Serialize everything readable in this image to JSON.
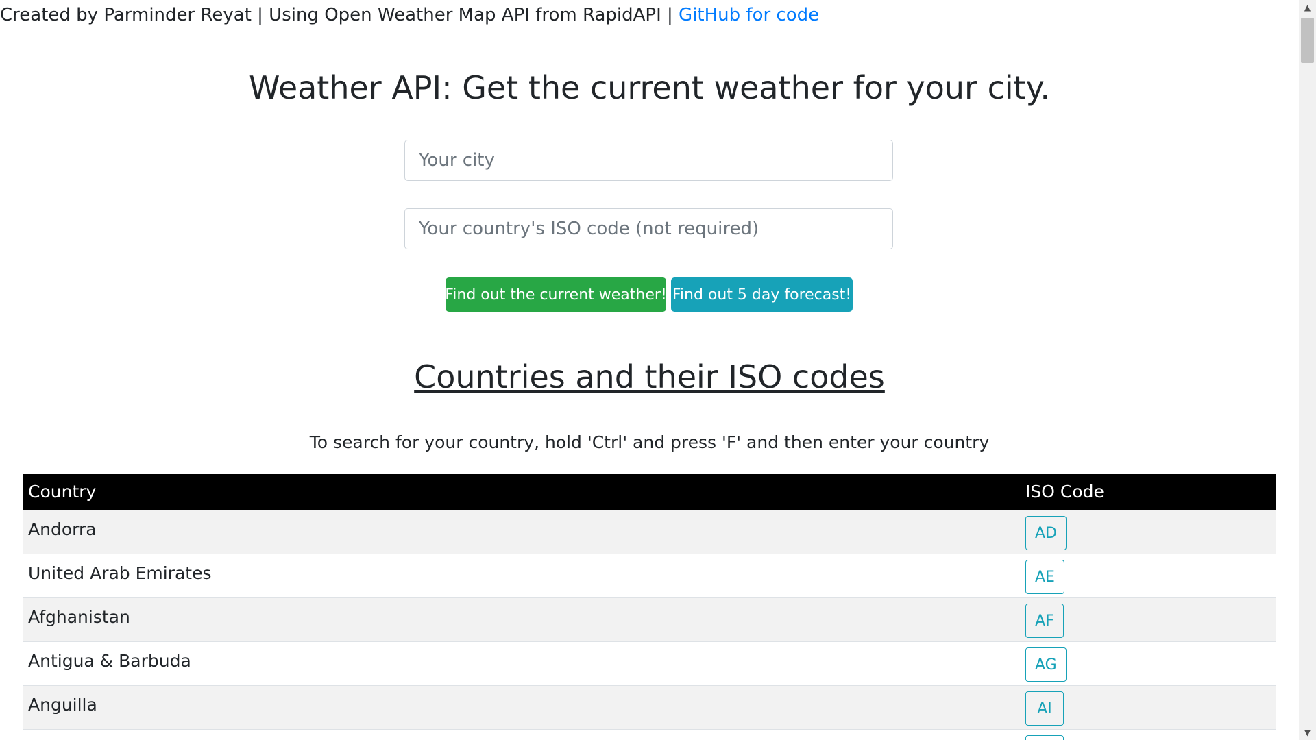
{
  "header": {
    "credit_text": "Created by Parminder Reyat | Using Open Weather Map API from RapidAPI | ",
    "github_link": "GitHub for code"
  },
  "title": "Weather API: Get the current weather for your city.",
  "form": {
    "city_placeholder": "Your city",
    "iso_placeholder": "Your country's ISO code (not required)",
    "current_button": "Find out the current weather!",
    "forecast_button": "Find out 5 day forecast!"
  },
  "countries_section": {
    "title": "Countries and their ISO codes",
    "instructions": "To search for your country, hold 'Ctrl' and press 'F' and then enter your country"
  },
  "table": {
    "headers": [
      "Country",
      "ISO Code"
    ],
    "rows": [
      {
        "country": "Andorra",
        "code": "AD"
      },
      {
        "country": "United Arab Emirates",
        "code": "AE"
      },
      {
        "country": "Afghanistan",
        "code": "AF"
      },
      {
        "country": "Antigua & Barbuda",
        "code": "AG"
      },
      {
        "country": "Anguilla",
        "code": "AI"
      }
    ]
  },
  "colors": {
    "link": "#007bff",
    "success_button": "#28a745",
    "info_button": "#17a2b8",
    "table_header": "#000000",
    "stripe": "#f2f2f2"
  },
  "icons": {
    "scroll_up": "triangle-up-icon",
    "scroll_down": "triangle-down-icon"
  }
}
